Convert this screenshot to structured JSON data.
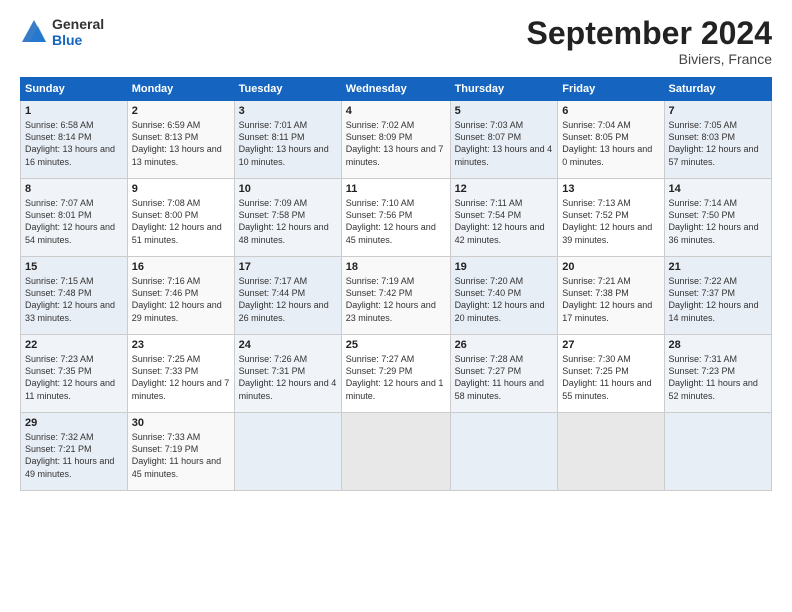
{
  "logo": {
    "general": "General",
    "blue": "Blue"
  },
  "title": "September 2024",
  "subtitle": "Biviers, France",
  "days_header": [
    "Sunday",
    "Monday",
    "Tuesday",
    "Wednesday",
    "Thursday",
    "Friday",
    "Saturday"
  ],
  "weeks": [
    [
      {
        "num": "1",
        "sunrise": "Sunrise: 6:58 AM",
        "sunset": "Sunset: 8:14 PM",
        "daylight": "Daylight: 13 hours and 16 minutes."
      },
      {
        "num": "2",
        "sunrise": "Sunrise: 6:59 AM",
        "sunset": "Sunset: 8:13 PM",
        "daylight": "Daylight: 13 hours and 13 minutes."
      },
      {
        "num": "3",
        "sunrise": "Sunrise: 7:01 AM",
        "sunset": "Sunset: 8:11 PM",
        "daylight": "Daylight: 13 hours and 10 minutes."
      },
      {
        "num": "4",
        "sunrise": "Sunrise: 7:02 AM",
        "sunset": "Sunset: 8:09 PM",
        "daylight": "Daylight: 13 hours and 7 minutes."
      },
      {
        "num": "5",
        "sunrise": "Sunrise: 7:03 AM",
        "sunset": "Sunset: 8:07 PM",
        "daylight": "Daylight: 13 hours and 4 minutes."
      },
      {
        "num": "6",
        "sunrise": "Sunrise: 7:04 AM",
        "sunset": "Sunset: 8:05 PM",
        "daylight": "Daylight: 13 hours and 0 minutes."
      },
      {
        "num": "7",
        "sunrise": "Sunrise: 7:05 AM",
        "sunset": "Sunset: 8:03 PM",
        "daylight": "Daylight: 12 hours and 57 minutes."
      }
    ],
    [
      {
        "num": "8",
        "sunrise": "Sunrise: 7:07 AM",
        "sunset": "Sunset: 8:01 PM",
        "daylight": "Daylight: 12 hours and 54 minutes."
      },
      {
        "num": "9",
        "sunrise": "Sunrise: 7:08 AM",
        "sunset": "Sunset: 8:00 PM",
        "daylight": "Daylight: 12 hours and 51 minutes."
      },
      {
        "num": "10",
        "sunrise": "Sunrise: 7:09 AM",
        "sunset": "Sunset: 7:58 PM",
        "daylight": "Daylight: 12 hours and 48 minutes."
      },
      {
        "num": "11",
        "sunrise": "Sunrise: 7:10 AM",
        "sunset": "Sunset: 7:56 PM",
        "daylight": "Daylight: 12 hours and 45 minutes."
      },
      {
        "num": "12",
        "sunrise": "Sunrise: 7:11 AM",
        "sunset": "Sunset: 7:54 PM",
        "daylight": "Daylight: 12 hours and 42 minutes."
      },
      {
        "num": "13",
        "sunrise": "Sunrise: 7:13 AM",
        "sunset": "Sunset: 7:52 PM",
        "daylight": "Daylight: 12 hours and 39 minutes."
      },
      {
        "num": "14",
        "sunrise": "Sunrise: 7:14 AM",
        "sunset": "Sunset: 7:50 PM",
        "daylight": "Daylight: 12 hours and 36 minutes."
      }
    ],
    [
      {
        "num": "15",
        "sunrise": "Sunrise: 7:15 AM",
        "sunset": "Sunset: 7:48 PM",
        "daylight": "Daylight: 12 hours and 33 minutes."
      },
      {
        "num": "16",
        "sunrise": "Sunrise: 7:16 AM",
        "sunset": "Sunset: 7:46 PM",
        "daylight": "Daylight: 12 hours and 29 minutes."
      },
      {
        "num": "17",
        "sunrise": "Sunrise: 7:17 AM",
        "sunset": "Sunset: 7:44 PM",
        "daylight": "Daylight: 12 hours and 26 minutes."
      },
      {
        "num": "18",
        "sunrise": "Sunrise: 7:19 AM",
        "sunset": "Sunset: 7:42 PM",
        "daylight": "Daylight: 12 hours and 23 minutes."
      },
      {
        "num": "19",
        "sunrise": "Sunrise: 7:20 AM",
        "sunset": "Sunset: 7:40 PM",
        "daylight": "Daylight: 12 hours and 20 minutes."
      },
      {
        "num": "20",
        "sunrise": "Sunrise: 7:21 AM",
        "sunset": "Sunset: 7:38 PM",
        "daylight": "Daylight: 12 hours and 17 minutes."
      },
      {
        "num": "21",
        "sunrise": "Sunrise: 7:22 AM",
        "sunset": "Sunset: 7:37 PM",
        "daylight": "Daylight: 12 hours and 14 minutes."
      }
    ],
    [
      {
        "num": "22",
        "sunrise": "Sunrise: 7:23 AM",
        "sunset": "Sunset: 7:35 PM",
        "daylight": "Daylight: 12 hours and 11 minutes."
      },
      {
        "num": "23",
        "sunrise": "Sunrise: 7:25 AM",
        "sunset": "Sunset: 7:33 PM",
        "daylight": "Daylight: 12 hours and 7 minutes."
      },
      {
        "num": "24",
        "sunrise": "Sunrise: 7:26 AM",
        "sunset": "Sunset: 7:31 PM",
        "daylight": "Daylight: 12 hours and 4 minutes."
      },
      {
        "num": "25",
        "sunrise": "Sunrise: 7:27 AM",
        "sunset": "Sunset: 7:29 PM",
        "daylight": "Daylight: 12 hours and 1 minute."
      },
      {
        "num": "26",
        "sunrise": "Sunrise: 7:28 AM",
        "sunset": "Sunset: 7:27 PM",
        "daylight": "Daylight: 11 hours and 58 minutes."
      },
      {
        "num": "27",
        "sunrise": "Sunrise: 7:30 AM",
        "sunset": "Sunset: 7:25 PM",
        "daylight": "Daylight: 11 hours and 55 minutes."
      },
      {
        "num": "28",
        "sunrise": "Sunrise: 7:31 AM",
        "sunset": "Sunset: 7:23 PM",
        "daylight": "Daylight: 11 hours and 52 minutes."
      }
    ],
    [
      {
        "num": "29",
        "sunrise": "Sunrise: 7:32 AM",
        "sunset": "Sunset: 7:21 PM",
        "daylight": "Daylight: 11 hours and 49 minutes."
      },
      {
        "num": "30",
        "sunrise": "Sunrise: 7:33 AM",
        "sunset": "Sunset: 7:19 PM",
        "daylight": "Daylight: 11 hours and 45 minutes."
      },
      null,
      null,
      null,
      null,
      null
    ]
  ]
}
